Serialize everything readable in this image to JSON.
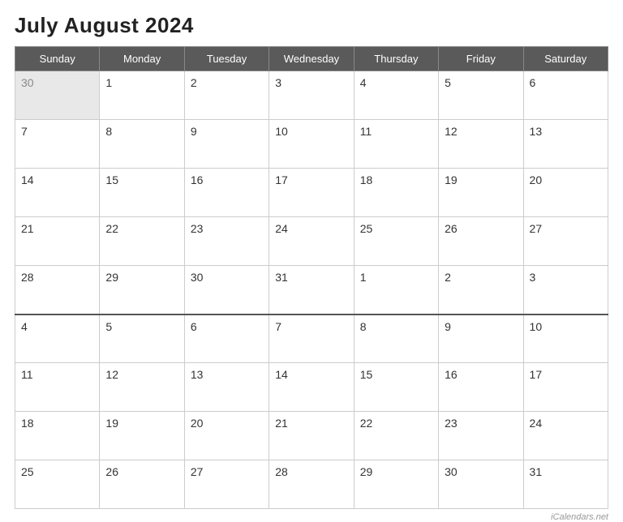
{
  "title": "July August 2024",
  "days_of_week": [
    "Sunday",
    "Monday",
    "Tuesday",
    "Wednesday",
    "Thursday",
    "Friday",
    "Saturday"
  ],
  "weeks": [
    {
      "divider": false,
      "days": [
        {
          "num": "30",
          "grayed": true
        },
        {
          "num": "1",
          "grayed": false
        },
        {
          "num": "2",
          "grayed": false
        },
        {
          "num": "3",
          "grayed": false
        },
        {
          "num": "4",
          "grayed": false
        },
        {
          "num": "5",
          "grayed": false
        },
        {
          "num": "6",
          "grayed": false
        }
      ]
    },
    {
      "divider": false,
      "days": [
        {
          "num": "7",
          "grayed": false
        },
        {
          "num": "8",
          "grayed": false
        },
        {
          "num": "9",
          "grayed": false
        },
        {
          "num": "10",
          "grayed": false
        },
        {
          "num": "11",
          "grayed": false
        },
        {
          "num": "12",
          "grayed": false
        },
        {
          "num": "13",
          "grayed": false
        }
      ]
    },
    {
      "divider": false,
      "days": [
        {
          "num": "14",
          "grayed": false
        },
        {
          "num": "15",
          "grayed": false
        },
        {
          "num": "16",
          "grayed": false
        },
        {
          "num": "17",
          "grayed": false
        },
        {
          "num": "18",
          "grayed": false
        },
        {
          "num": "19",
          "grayed": false
        },
        {
          "num": "20",
          "grayed": false
        }
      ]
    },
    {
      "divider": false,
      "days": [
        {
          "num": "21",
          "grayed": false
        },
        {
          "num": "22",
          "grayed": false
        },
        {
          "num": "23",
          "grayed": false
        },
        {
          "num": "24",
          "grayed": false
        },
        {
          "num": "25",
          "grayed": false
        },
        {
          "num": "26",
          "grayed": false
        },
        {
          "num": "27",
          "grayed": false
        }
      ]
    },
    {
      "divider": false,
      "days": [
        {
          "num": "28",
          "grayed": false
        },
        {
          "num": "29",
          "grayed": false
        },
        {
          "num": "30",
          "grayed": false
        },
        {
          "num": "31",
          "grayed": false
        },
        {
          "num": "1",
          "grayed": false
        },
        {
          "num": "2",
          "grayed": false
        },
        {
          "num": "3",
          "grayed": false
        }
      ]
    },
    {
      "divider": true,
      "days": [
        {
          "num": "4",
          "grayed": false
        },
        {
          "num": "5",
          "grayed": false
        },
        {
          "num": "6",
          "grayed": false
        },
        {
          "num": "7",
          "grayed": false
        },
        {
          "num": "8",
          "grayed": false
        },
        {
          "num": "9",
          "grayed": false
        },
        {
          "num": "10",
          "grayed": false
        }
      ]
    },
    {
      "divider": false,
      "days": [
        {
          "num": "11",
          "grayed": false
        },
        {
          "num": "12",
          "grayed": false
        },
        {
          "num": "13",
          "grayed": false
        },
        {
          "num": "14",
          "grayed": false
        },
        {
          "num": "15",
          "grayed": false
        },
        {
          "num": "16",
          "grayed": false
        },
        {
          "num": "17",
          "grayed": false
        }
      ]
    },
    {
      "divider": false,
      "days": [
        {
          "num": "18",
          "grayed": false
        },
        {
          "num": "19",
          "grayed": false
        },
        {
          "num": "20",
          "grayed": false
        },
        {
          "num": "21",
          "grayed": false
        },
        {
          "num": "22",
          "grayed": false
        },
        {
          "num": "23",
          "grayed": false
        },
        {
          "num": "24",
          "grayed": false
        }
      ]
    },
    {
      "divider": false,
      "days": [
        {
          "num": "25",
          "grayed": false
        },
        {
          "num": "26",
          "grayed": false
        },
        {
          "num": "27",
          "grayed": false
        },
        {
          "num": "28",
          "grayed": false
        },
        {
          "num": "29",
          "grayed": false
        },
        {
          "num": "30",
          "grayed": false
        },
        {
          "num": "31",
          "grayed": false
        }
      ]
    }
  ],
  "watermark": "iCalendars.net"
}
